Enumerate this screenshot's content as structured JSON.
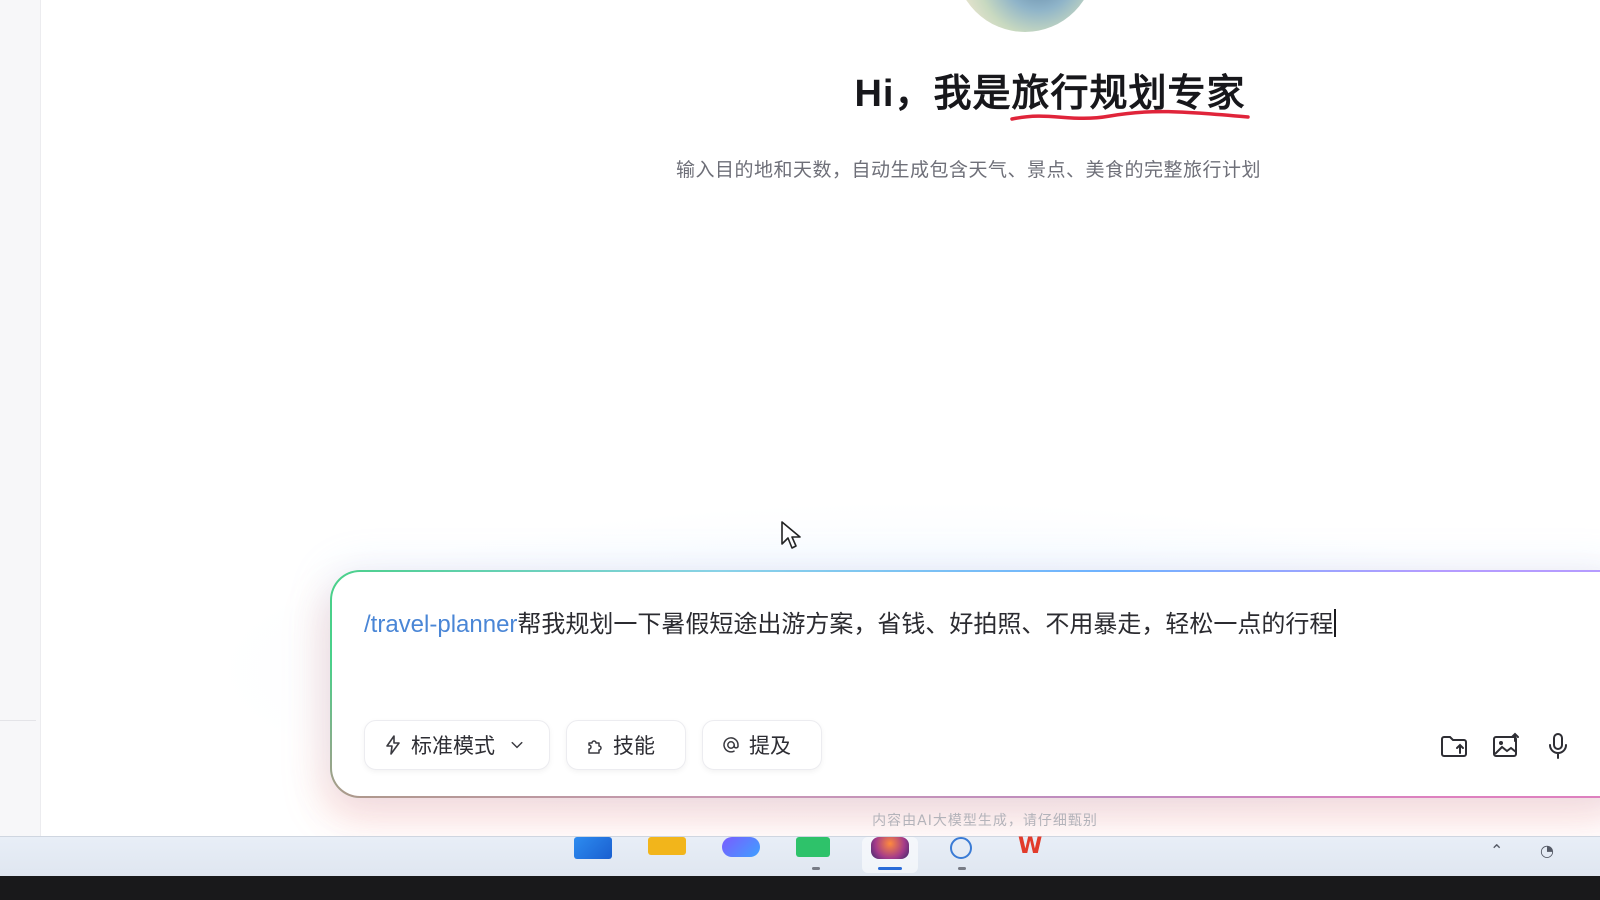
{
  "hero": {
    "greeting": "Hi，我是",
    "role": "旅行规划专家",
    "subtitle": "输入目的地和天数，自动生成包含天气、景点、美食的完整旅行计划"
  },
  "composer": {
    "command": "/travel-planner",
    "prompt_text": "帮我规划一下暑假短途出游方案，省钱、好拍照、不用暴走，轻松一点的行程",
    "mode_label": "标准模式",
    "skills_label": "技能",
    "mention_label": "提及",
    "icons": [
      "lightning-icon",
      "puzzle-icon",
      "at-icon",
      "folder-upload-icon",
      "image-upload-icon",
      "microphone-icon"
    ]
  },
  "disclaimer": "内容由AI大模型生成，请仔细甄别",
  "colors": {
    "command": "#4a86d6",
    "underline": "#e0243a",
    "border_gradient": [
      "#4ad08a",
      "#6fb2ff",
      "#b59cff",
      "#ff6a8a"
    ]
  },
  "taskbar": {
    "apps": [
      "windows-start-icon",
      "file-explorer-icon",
      "ai-app-icon",
      "green-app-icon",
      "active-app-icon",
      "network-app-icon",
      "wps-icon"
    ],
    "active_app": "active-app-icon"
  }
}
